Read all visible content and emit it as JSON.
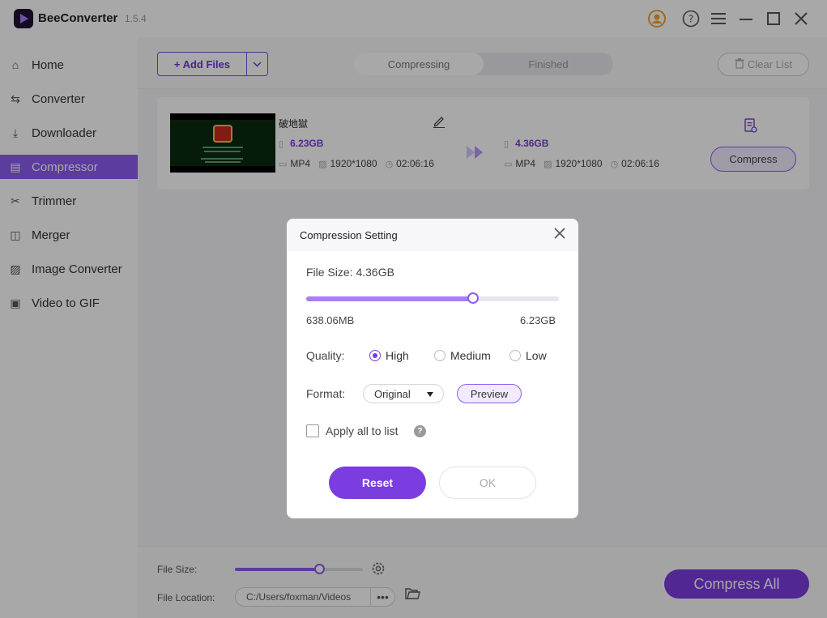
{
  "app": {
    "name": "BeeConverter",
    "version": "1.5.4"
  },
  "sidebar": {
    "items": [
      {
        "label": "Home",
        "icon": "home-icon"
      },
      {
        "label": "Converter",
        "icon": "swap-icon"
      },
      {
        "label": "Downloader",
        "icon": "download-icon"
      },
      {
        "label": "Compressor",
        "icon": "compress-icon",
        "active": true
      },
      {
        "label": "Trimmer",
        "icon": "scissors-icon"
      },
      {
        "label": "Merger",
        "icon": "merge-icon"
      },
      {
        "label": "Image Converter",
        "icon": "image-icon"
      },
      {
        "label": "Video to GIF",
        "icon": "gif-icon"
      }
    ]
  },
  "toolbar": {
    "add_files": "+ Add Files",
    "tabs": [
      "Compressing",
      "Finished"
    ],
    "active_tab": "Compressing",
    "clear_list": "Clear List"
  },
  "file": {
    "name": "破地獄",
    "original": {
      "size": "6.23GB",
      "format": "MP4",
      "resolution": "1920*1080",
      "duration": "02:06:16"
    },
    "output": {
      "size": "4.36GB",
      "format": "MP4",
      "resolution": "1920*1080",
      "duration": "02:06:16"
    },
    "compress_button": "Compress"
  },
  "bottom": {
    "file_size_label": "File Size:",
    "file_size_fraction": 0.66,
    "file_location_label": "File Location:",
    "file_location": "C:/Users/foxman/Videos",
    "compress_all": "Compress All"
  },
  "modal": {
    "title": "Compression Setting",
    "file_size_text": "File Size: 4.36GB",
    "slider_fraction": 0.66,
    "min_label": "638.06MB",
    "max_label": "6.23GB",
    "quality_label": "Quality:",
    "quality_options": [
      "High",
      "Medium",
      "Low"
    ],
    "quality_selected": "High",
    "format_label": "Format:",
    "format_value": "Original",
    "preview_label": "Preview",
    "apply_all_label": "Apply all to list",
    "reset_label": "Reset",
    "ok_label": "OK"
  },
  "colors": {
    "accent": "#7b3ce0",
    "accent_light": "#8c5cf0",
    "slider_fill": "#a97df4"
  }
}
